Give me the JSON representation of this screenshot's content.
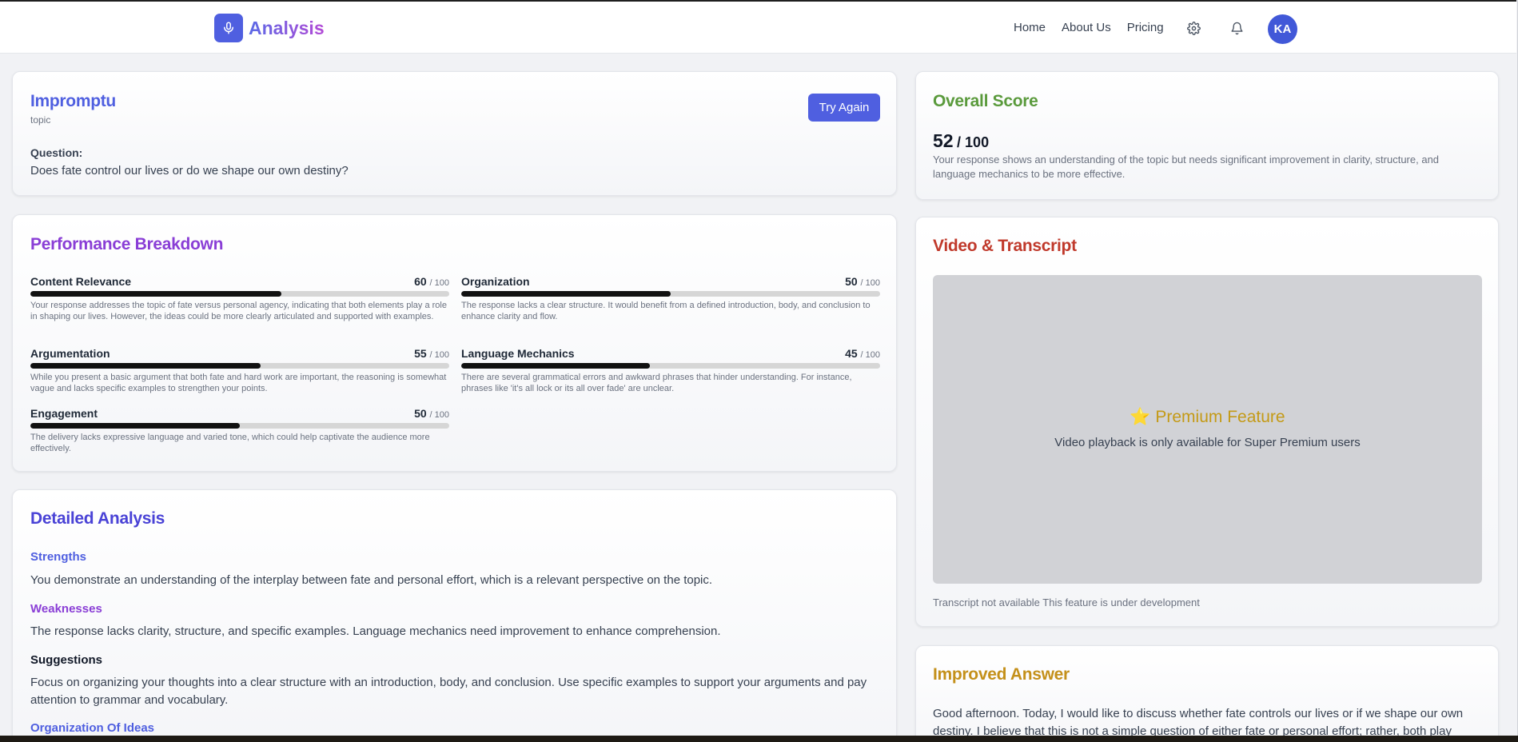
{
  "nav": {
    "brand": "Analysis",
    "links": [
      "Home",
      "About Us",
      "Pricing"
    ],
    "avatar_initials": "KA"
  },
  "topic_card": {
    "title": "Impromptu",
    "subtitle": "topic",
    "question_label": "Question:",
    "question": "Does fate control our lives or do we shape our own destiny?",
    "button": "Try Again"
  },
  "overall": {
    "title": "Overall Score",
    "score": "52",
    "out_of": "/ 100",
    "description": "Your response shows an understanding of the topic but needs significant improvement in clarity, structure, and language mechanics to be more effective."
  },
  "breakdown": {
    "title": "Performance Breakdown",
    "metrics": [
      {
        "name": "Content Relevance",
        "score": "60",
        "out_of": "/ 100",
        "fraction": 0.6,
        "description": "Your response addresses the topic of fate versus personal agency, indicating that both elements play a role in shaping our lives. However, the ideas could be more clearly articulated and supported with examples."
      },
      {
        "name": "Organization",
        "score": "50",
        "out_of": "/ 100",
        "fraction": 0.5,
        "description": "The response lacks a clear structure. It would benefit from a defined introduction, body, and conclusion to enhance clarity and flow."
      },
      {
        "name": "Argumentation",
        "score": "55",
        "out_of": "/ 100",
        "fraction": 0.55,
        "description": "While you present a basic argument that both fate and hard work are important, the reasoning is somewhat vague and lacks specific examples to strengthen your points."
      },
      {
        "name": "Language Mechanics",
        "score": "45",
        "out_of": "/ 100",
        "fraction": 0.45,
        "description": "There are several grammatical errors and awkward phrases that hinder understanding. For instance, phrases like 'it's all lock or its all over fade' are unclear."
      },
      {
        "name": "Engagement",
        "score": "50",
        "out_of": "/ 100",
        "fraction": 0.5,
        "description": "The delivery lacks expressive language and varied tone, which could help captivate the audience more effectively."
      }
    ]
  },
  "video": {
    "title": "Video & Transcript",
    "premium_title": "⭐ Premium Feature",
    "premium_sub": "Video playback is only available for Super Premium users",
    "transcript_note": "Transcript not available This feature is under development"
  },
  "detailed": {
    "title": "Detailed Analysis",
    "strengths_head": "Strengths",
    "strengths": "You demonstrate an understanding of the interplay between fate and personal effort, which is a relevant perspective on the topic.",
    "weaknesses_head": "Weaknesses",
    "weaknesses": "The response lacks clarity, structure, and specific examples. Language mechanics need improvement to enhance comprehension.",
    "suggestions_head": "Suggestions",
    "suggestions": "Focus on organizing your thoughts into a clear structure with an introduction, body, and conclusion. Use specific examples to support your arguments and pay attention to grammar and vocabulary.",
    "organization_head": "Organization Of Ideas"
  },
  "improved": {
    "title": "Improved Answer",
    "text": "Good afternoon. Today, I would like to discuss whether fate controls our lives or if we shape our own destiny. I believe that this is not a simple question of either fate or personal effort; rather, both play"
  },
  "colors": {
    "accent": "#4f5fe0",
    "overall_title": "#5a9a3c",
    "breakdown_title": "#8a3ed6",
    "video_title": "#c0392b",
    "improved_title": "#c4901a"
  }
}
